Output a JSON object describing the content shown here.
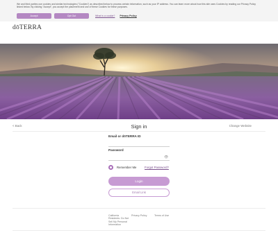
{
  "cookie_banner": {
    "text": "We and third parties use cookies and similar technologies (\"Cookies\") as described below to process certain information, such as your IP address. You can learn more about how this site uses Cookies by reading our Privacy Policy linked below. By clicking \"Accept\", you accept the placement and use of these Cookies for these purposes.",
    "accept_label": "Accept",
    "optout_label": "Opt Out",
    "what_cookies_label": "What is a cookie?",
    "privacy_policy_label": "Privacy Policy",
    "button_color": "#b488c2"
  },
  "header": {
    "logo_text": "dōTERRA"
  },
  "hero": {
    "alt_description_hidden": ""
  },
  "signin": {
    "back_label": "< Back",
    "title": "Sign in",
    "change_website_label": "Change Website",
    "email_label": "Email or dōTERRA ID",
    "email_value": "",
    "password_label": "Password",
    "password_value": "",
    "remember_me_label": "Remember Me",
    "forgot_password_label": "Forgot Password?",
    "login_label": "Login",
    "email_link_label": "Email Link",
    "accent_color": "#c79bd3"
  },
  "footer": {
    "links": [
      "California Residents: Do Not Sell My Personal Information",
      "Privacy Policy",
      "Terms of Use"
    ]
  }
}
